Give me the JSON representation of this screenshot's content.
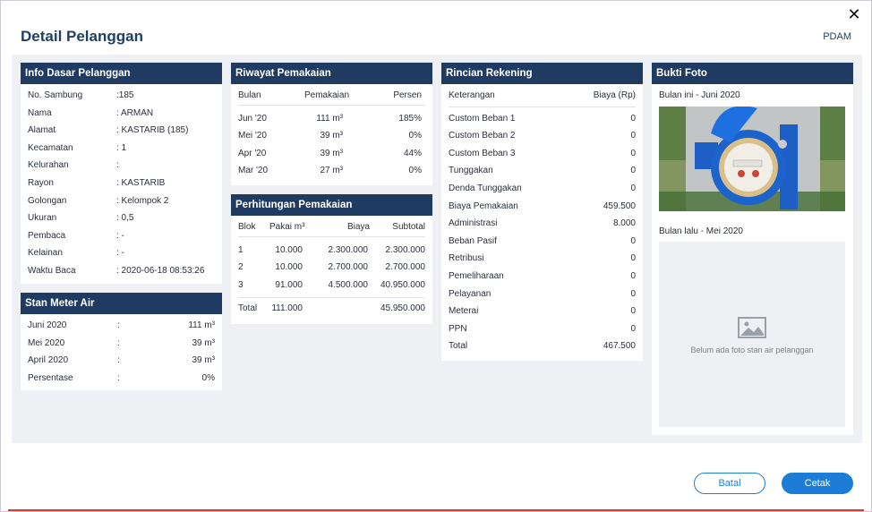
{
  "modal": {
    "title": "Detail Pelanggan",
    "org": "PDAM",
    "close_label": "✕"
  },
  "info_dasar": {
    "header": "Info Dasar Pelanggan",
    "rows": [
      {
        "label": "No. Sambung",
        "value": ":185"
      },
      {
        "label": "Nama",
        "value": ": ARMAN"
      },
      {
        "label": "Alamat",
        "value": ": KASTARIB (185)"
      },
      {
        "label": "Kecamatan",
        "value": ": 1"
      },
      {
        "label": "Kelurahan",
        "value": ":"
      },
      {
        "label": "Rayon",
        "value": ": KASTARIB"
      },
      {
        "label": "Golongan",
        "value": ": Kelompok 2"
      },
      {
        "label": "Ukuran",
        "value": ": 0,5"
      },
      {
        "label": "Pembaca",
        "value": ": -"
      },
      {
        "label": "Kelainan",
        "value": ": -"
      },
      {
        "label": "Waktu Baca",
        "value": ": 2020-06-18 08:53:26"
      }
    ]
  },
  "stan_meter": {
    "header": "Stan Meter Air",
    "rows": [
      {
        "label": "Juni 2020",
        "sep": ":",
        "value": "111 m³"
      },
      {
        "label": "Mei 2020",
        "sep": ":",
        "value": "39 m³"
      },
      {
        "label": "April 2020",
        "sep": ":",
        "value": "39 m³"
      },
      {
        "label": "Persentase",
        "sep": ":",
        "value": "0%"
      }
    ]
  },
  "riwayat": {
    "header": "Riwayat Pemakaian",
    "columns": [
      "Bulan",
      "Pemakaian",
      "Persen"
    ],
    "rows": [
      {
        "bulan": "Jun '20",
        "pemakaian": "111 m³",
        "persen": "185%"
      },
      {
        "bulan": "Mei '20",
        "pemakaian": "39 m³",
        "persen": "0%"
      },
      {
        "bulan": "Apr '20",
        "pemakaian": "39 m³",
        "persen": "44%"
      },
      {
        "bulan": "Mar '20",
        "pemakaian": "27 m³",
        "persen": "0%"
      }
    ]
  },
  "perhitungan": {
    "header": "Perhitungan Pemakaian",
    "columns": [
      "Blok",
      "Pakai m³",
      "Biaya",
      "Subtotal"
    ],
    "rows": [
      {
        "blok": "1",
        "pakai": "10.000",
        "biaya": "2.300.000",
        "subtotal": "2.300.000"
      },
      {
        "blok": "2",
        "pakai": "10.000",
        "biaya": "2.700.000",
        "subtotal": "2.700.000"
      },
      {
        "blok": "3",
        "pakai": "91.000",
        "biaya": "4.500.000",
        "subtotal": "40.950.000"
      }
    ],
    "total": {
      "label": "Total",
      "pakai": "111.000",
      "subtotal": "45.950.000"
    }
  },
  "rincian": {
    "header": "Rincian Rekening",
    "columns": [
      "Keterangan",
      "Biaya (Rp)"
    ],
    "rows": [
      {
        "ket": "Custom Beban 1",
        "biaya": "0"
      },
      {
        "ket": "Custom Beban 2",
        "biaya": "0"
      },
      {
        "ket": "Custom Beban 3",
        "biaya": "0"
      },
      {
        "ket": "Tunggakan",
        "biaya": "0"
      },
      {
        "ket": "Denda Tunggakan",
        "biaya": "0"
      },
      {
        "ket": "Biaya Pemakaian",
        "biaya": "459.500"
      },
      {
        "ket": "Administrasi",
        "biaya": "8.000"
      },
      {
        "ket": "Beban Pasif",
        "biaya": "0"
      },
      {
        "ket": "Retribusi",
        "biaya": "0"
      },
      {
        "ket": "Pemeliharaan",
        "biaya": "0"
      },
      {
        "ket": "Pelayanan",
        "biaya": "0"
      },
      {
        "ket": "Meterai",
        "biaya": "0"
      },
      {
        "ket": "PPN",
        "biaya": "0"
      },
      {
        "ket": "Total",
        "biaya": "467.500"
      }
    ]
  },
  "bukti_foto": {
    "header": "Bukti Foto",
    "current_label": "Bulan ini - Juni 2020",
    "previous_label": "Bulan lalu - Mei 2020",
    "placeholder_text": "Belum ada foto stan air pelanggan",
    "placeholder_icon": "image-placeholder-icon"
  },
  "buttons": {
    "cancel": "Batal",
    "print": "Cetak"
  },
  "colors": {
    "header_bg": "#1f3b61",
    "primary": "#1d7dd6",
    "title": "#1f4066"
  }
}
